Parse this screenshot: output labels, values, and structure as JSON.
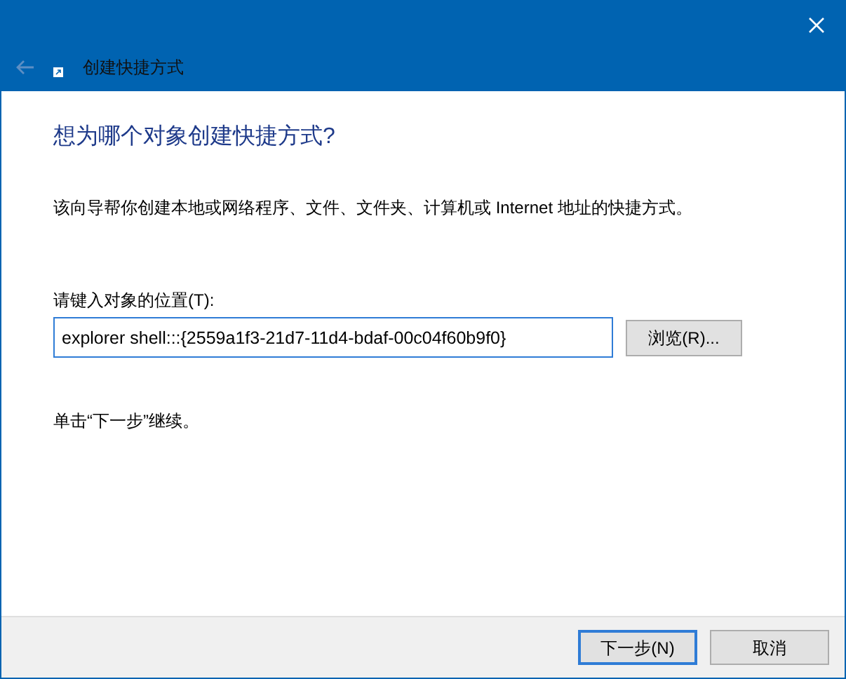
{
  "window": {
    "title": "创建快捷方式",
    "back_disabled": true
  },
  "heading": "想为哪个对象创建快捷方式?",
  "description": "该向导帮你创建本地或网络程序、文件、文件夹、计算机或 Internet 地址的快捷方式。",
  "location": {
    "label": "请键入对象的位置(T):",
    "value": "explorer shell:::{2559a1f3-21d7-11d4-bdaf-00c04f60b9f0}",
    "browse_button": "浏览(R)..."
  },
  "hint": "单击“下一步”继续。",
  "buttons": [
    {
      "label": "下一步(N)",
      "default": true
    },
    {
      "label": "取消",
      "default": false
    }
  ]
}
